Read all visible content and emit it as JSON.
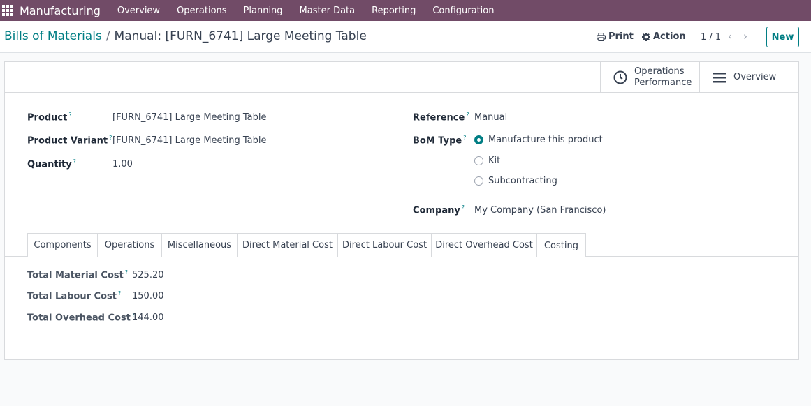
{
  "navbar": {
    "brand": "Manufacturing",
    "menu": [
      "Overview",
      "Operations",
      "Planning",
      "Master Data",
      "Reporting",
      "Configuration"
    ]
  },
  "control_panel": {
    "breadcrumb_parent": "Bills of Materials",
    "breadcrumb_separator": "/",
    "breadcrumb_current": "Manual: [FURN_6741] Large Meeting Table",
    "print_label": "Print",
    "action_label": "Action",
    "pager": "1 / 1",
    "new_label": "New"
  },
  "smart_buttons": {
    "operations_performance_line1": "Operations",
    "operations_performance_line2": "Performance",
    "overview_label": "Overview"
  },
  "form": {
    "product_label": "Product",
    "product_value": "[FURN_6741] Large Meeting Table",
    "variant_label": "Product Variant",
    "variant_value": "[FURN_6741] Large Meeting Table",
    "quantity_label": "Quantity",
    "quantity_value": "1.00",
    "reference_label": "Reference",
    "reference_value": "Manual",
    "bom_type_label": "BoM Type",
    "bom_type_options": [
      "Manufacture this product",
      "Kit",
      "Subcontracting"
    ],
    "bom_type_selected": "Manufacture this product",
    "company_label": "Company",
    "company_value": "My Company (San Francisco)",
    "help_marker": "?"
  },
  "tabs": [
    "Components",
    "Operations",
    "Miscellaneous",
    "Direct Material Cost",
    "Direct Labour Cost",
    "Direct Overhead Cost",
    "Costing"
  ],
  "active_tab": "Costing",
  "costing": {
    "total_material_label": "Total Material Cost",
    "total_material_value": "525.20",
    "total_labour_label": "Total Labour Cost",
    "total_labour_value": "150.00",
    "total_overhead_label": "Total Overhead Cost",
    "total_overhead_value": "144.00"
  },
  "colors": {
    "navbar": "#714b67",
    "accent": "#017e84"
  }
}
